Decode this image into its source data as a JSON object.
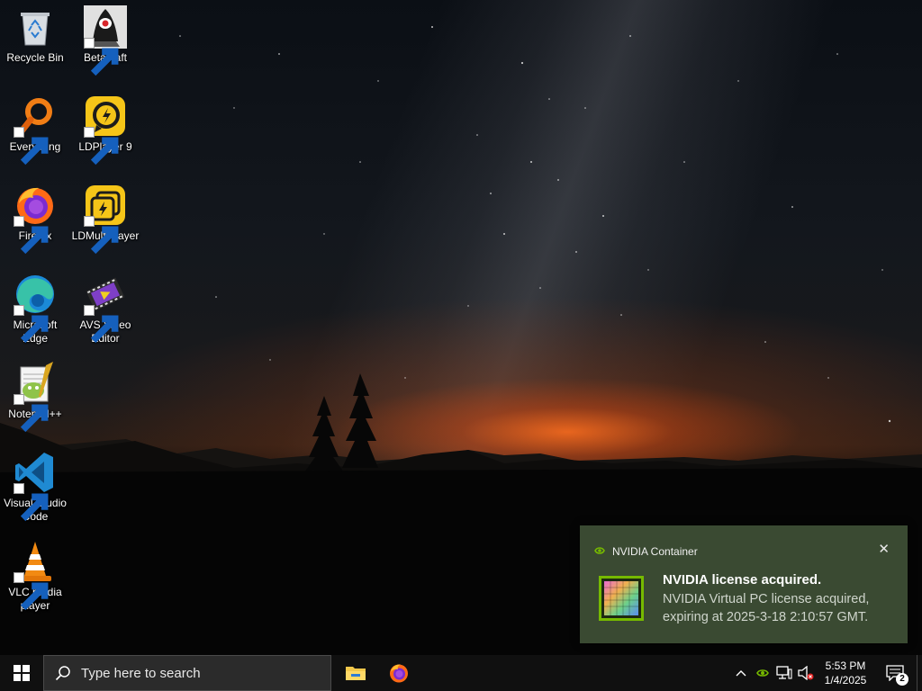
{
  "desktop": {
    "icons": [
      {
        "label": "Recycle Bin",
        "icon": "recycle-bin-icon"
      },
      {
        "label": "Betacraft",
        "icon": "betacraft-icon"
      },
      {
        "label": "Everything",
        "icon": "everything-search-icon"
      },
      {
        "label": "LDPlayer 9",
        "icon": "ldplayer-icon"
      },
      {
        "label": "Firefox",
        "icon": "firefox-icon"
      },
      {
        "label": "LDMultiPlayer",
        "icon": "ldmultiplayer-icon"
      },
      {
        "label": "Microsoft Edge",
        "icon": "edge-icon"
      },
      {
        "label": "AVS Video Editor",
        "icon": "avs-video-editor-icon"
      },
      {
        "label": "Notepad++",
        "icon": "notepad-plus-plus-icon"
      },
      {
        "label": "Visual Studio Code",
        "icon": "vscode-icon"
      },
      {
        "label": "VLC media player",
        "icon": "vlc-icon"
      }
    ]
  },
  "notification": {
    "app_name": "NVIDIA Container",
    "title": "NVIDIA license acquired.",
    "body": "NVIDIA Virtual PC license acquired, expiring at 2025-3-18 2:10:57 GMT.",
    "close_glyph": "✕",
    "accent_color": "#76b900",
    "background_color": "#3a4a32"
  },
  "taskbar": {
    "search_placeholder": "Type here to search",
    "pinned": [
      "file-explorer-icon",
      "firefox-icon"
    ],
    "tray_icons": [
      "chevron-up-icon",
      "nvidia-tray-icon",
      "network-icon",
      "volume-muted-icon"
    ],
    "clock": {
      "time": "5:53 PM",
      "date": "1/4/2025"
    },
    "notification_count": "2"
  }
}
